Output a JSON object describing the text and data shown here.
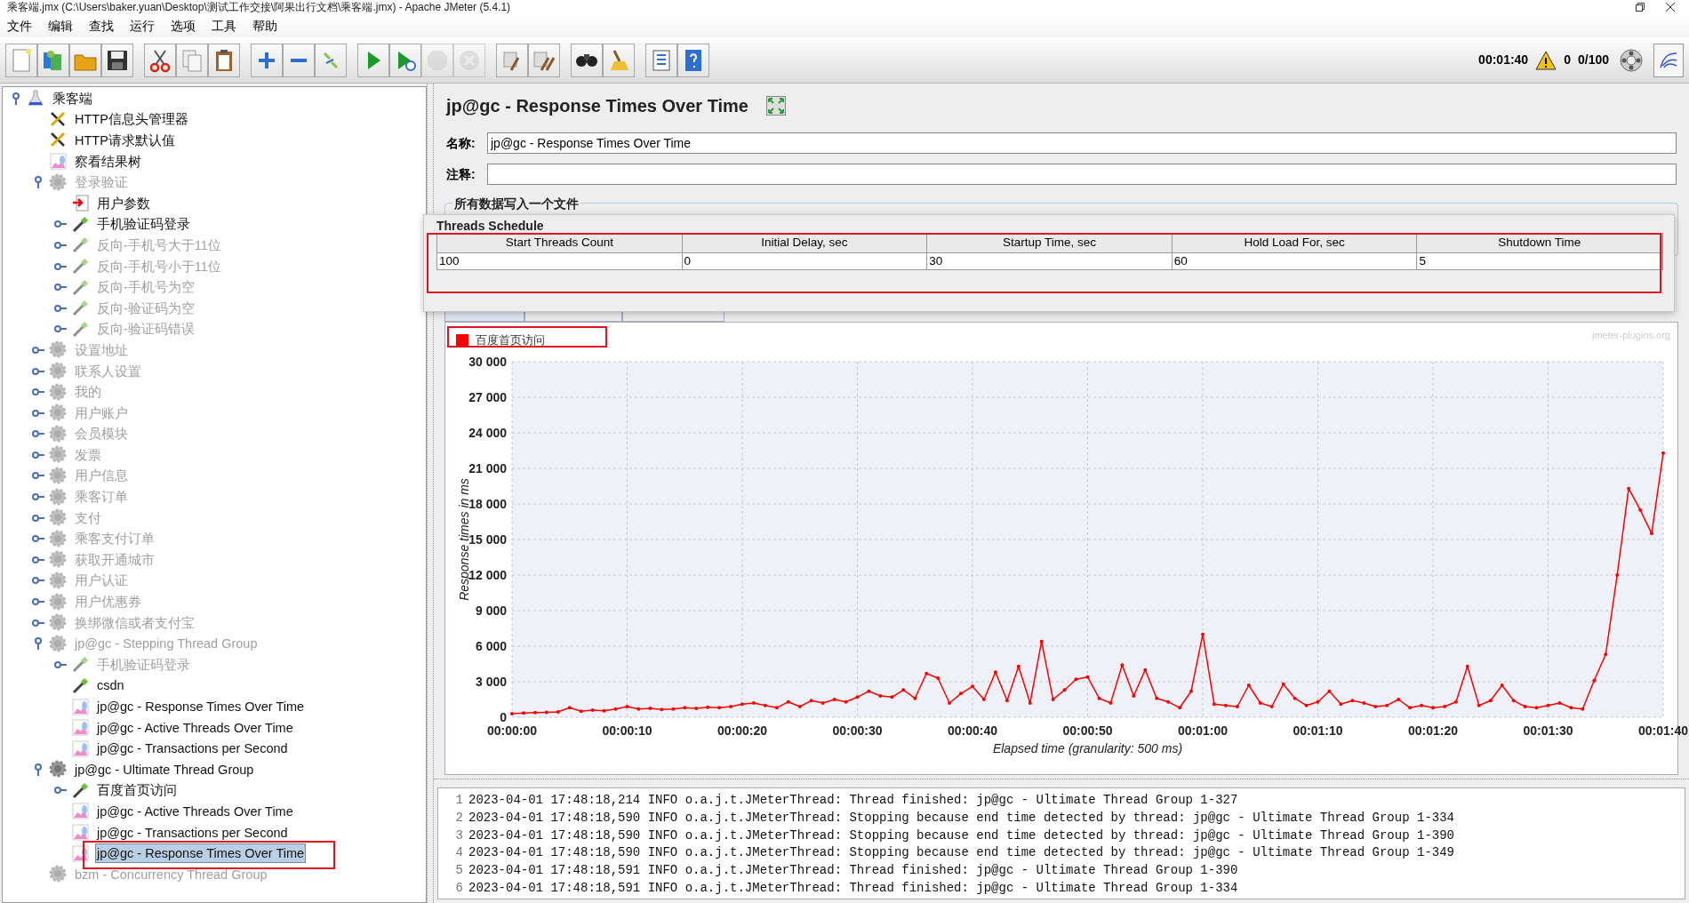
{
  "window": {
    "title": "乘客端.jmx (C:\\Users\\baker.yuan\\Desktop\\测试工作交接\\阿果出行文档\\乘客端.jmx) - Apache JMeter (5.4.1)"
  },
  "menu": [
    "文件",
    "编辑",
    "查找",
    "运行",
    "选项",
    "工具",
    "帮助"
  ],
  "toolbar": [
    {
      "disabled": false
    },
    {
      "disabled": false
    },
    {
      "disabled": false
    },
    {
      "disabled": false
    },
    {
      "disabled": false
    },
    {
      "disabled": false
    },
    {
      "disabled": false
    },
    {
      "disabled": false
    },
    {
      "disabled": false
    },
    {
      "disabled": false
    },
    {
      "disabled": false
    },
    {
      "disabled": false
    },
    {
      "disabled": true
    },
    {
      "disabled": true
    },
    {
      "disabled": false
    },
    {
      "disabled": false
    },
    {
      "disabled": false
    },
    {
      "disabled": false
    },
    {
      "disabled": false
    },
    {
      "disabled": false
    }
  ],
  "status": {
    "elapsed": "00:01:40",
    "errors": "0",
    "threads": "0/100"
  },
  "tree": [
    {
      "label": "乘客端",
      "kind": "plan",
      "disabled": false,
      "selected": false,
      "expanded": true,
      "children": [
        {
          "label": "HTTP信息头管理器",
          "kind": "config",
          "disabled": false,
          "selected": false
        },
        {
          "label": "HTTP请求默认值",
          "kind": "config",
          "disabled": false,
          "selected": false
        },
        {
          "label": "察看结果树",
          "kind": "listener",
          "disabled": false,
          "selected": false
        },
        {
          "label": "登录验证",
          "kind": "group",
          "disabled": true,
          "selected": false,
          "expanded": true,
          "children": [
            {
              "label": "用户参数",
              "kind": "preprocessor",
              "disabled": false,
              "selected": false
            },
            {
              "label": "手机验证码登录",
              "kind": "sampler",
              "disabled": false,
              "selected": false,
              "expanded": false
            },
            {
              "label": "反向-手机号大于11位",
              "kind": "sampler",
              "disabled": true,
              "selected": false,
              "expanded": false
            },
            {
              "label": "反向-手机号小于11位",
              "kind": "sampler",
              "disabled": true,
              "selected": false,
              "expanded": false
            },
            {
              "label": "反向-手机号为空",
              "kind": "sampler",
              "disabled": true,
              "selected": false,
              "expanded": false
            },
            {
              "label": "反向-验证码为空",
              "kind": "sampler",
              "disabled": true,
              "selected": false,
              "expanded": false
            },
            {
              "label": "反向-验证码错误",
              "kind": "sampler",
              "disabled": true,
              "selected": false,
              "expanded": false
            }
          ]
        },
        {
          "label": "设置地址",
          "kind": "group",
          "disabled": true,
          "selected": false,
          "expanded": false
        },
        {
          "label": "联系人设置",
          "kind": "group",
          "disabled": true,
          "selected": false,
          "expanded": false
        },
        {
          "label": "我的",
          "kind": "group",
          "disabled": true,
          "selected": false,
          "expanded": false
        },
        {
          "label": "用户账户",
          "kind": "group",
          "disabled": true,
          "selected": false,
          "expanded": false
        },
        {
          "label": "会员模块",
          "kind": "group",
          "disabled": true,
          "selected": false,
          "expanded": false
        },
        {
          "label": "发票",
          "kind": "group",
          "disabled": true,
          "selected": false,
          "expanded": false
        },
        {
          "label": "用户信息",
          "kind": "group",
          "disabled": true,
          "selected": false,
          "expanded": false
        },
        {
          "label": "乘客订单",
          "kind": "group",
          "disabled": true,
          "selected": false,
          "expanded": false
        },
        {
          "label": "支付",
          "kind": "group",
          "disabled": true,
          "selected": false,
          "expanded": false
        },
        {
          "label": "乘客支付订单",
          "kind": "group",
          "disabled": true,
          "selected": false,
          "expanded": false
        },
        {
          "label": "获取开通城市",
          "kind": "group",
          "disabled": true,
          "selected": false,
          "expanded": false
        },
        {
          "label": "用户认证",
          "kind": "group",
          "disabled": true,
          "selected": false,
          "expanded": false
        },
        {
          "label": "用户优惠券",
          "kind": "group",
          "disabled": true,
          "selected": false,
          "expanded": false
        },
        {
          "label": "换绑微信或者支付宝",
          "kind": "group",
          "disabled": true,
          "selected": false,
          "expanded": false
        },
        {
          "label": "jp@gc - Stepping Thread Group",
          "kind": "group",
          "disabled": true,
          "selected": false,
          "expanded": true,
          "children": [
            {
              "label": "手机验证码登录",
              "kind": "sampler",
              "disabled": true,
              "selected": false,
              "expanded": false
            },
            {
              "label": "csdn",
              "kind": "sampler",
              "disabled": false,
              "selected": false
            },
            {
              "label": "jp@gc - Response Times Over Time",
              "kind": "listener",
              "disabled": false,
              "selected": false
            },
            {
              "label": "jp@gc - Active Threads Over Time",
              "kind": "listener",
              "disabled": false,
              "selected": false
            },
            {
              "label": "jp@gc - Transactions per Second",
              "kind": "listener",
              "disabled": false,
              "selected": false
            }
          ]
        },
        {
          "label": "jp@gc - Ultimate Thread Group",
          "kind": "group",
          "disabled": false,
          "selected": false,
          "expanded": true,
          "children": [
            {
              "label": "百度首页访问",
              "kind": "sampler",
              "disabled": false,
              "selected": false,
              "expanded": false
            },
            {
              "label": "jp@gc - Active Threads Over Time",
              "kind": "listener",
              "disabled": false,
              "selected": false
            },
            {
              "label": "jp@gc - Transactions per Second",
              "kind": "listener",
              "disabled": false,
              "selected": false
            },
            {
              "label": "jp@gc - Response Times Over Time",
              "kind": "listener",
              "disabled": false,
              "selected": true
            }
          ]
        },
        {
          "label": "bzm - Concurrency Thread Group",
          "kind": "group",
          "disabled": true,
          "selected": false
        }
      ]
    }
  ],
  "panel": {
    "title": "jp@gc - Response Times Over Time",
    "name_label": "名称:",
    "name_value": "jp@gc - Response Times Over Time",
    "comment_label": "注释:",
    "file_legend": "所有数据写入一个文件"
  },
  "tabs": [
    {
      "selected": true
    },
    {
      "selected": false
    },
    {
      "selected": false
    }
  ],
  "threads_schedule": {
    "title": "Threads Schedule",
    "columns": [
      "Start Threads Count",
      "Initial Delay, sec",
      "Startup Time, sec",
      "Hold Load For, sec",
      "Shutdown Time"
    ],
    "row": [
      "100",
      "0",
      "30",
      "60",
      "5"
    ]
  },
  "chart": {
    "credit": "jmeter-plugins.org",
    "chart_data": {
      "type": "line",
      "xlabel": "Elapsed time (granularity: 500 ms)",
      "ylabel": "Response times in ms",
      "x": [
        0,
        1,
        2,
        3,
        4,
        5,
        6,
        7,
        8,
        9,
        10,
        11,
        12,
        13,
        14,
        15,
        16,
        17,
        18,
        19,
        20,
        21,
        22,
        23,
        24,
        25,
        26,
        27,
        28,
        29,
        30,
        31,
        32,
        33,
        34,
        35,
        36,
        37,
        38,
        39,
        40,
        41,
        42,
        43,
        44,
        45,
        46,
        47,
        48,
        49,
        50,
        51,
        52,
        53,
        54,
        55,
        56,
        57,
        58,
        59,
        60,
        61,
        62,
        63,
        64,
        65,
        66,
        67,
        68,
        69,
        70,
        71,
        72,
        73,
        74,
        75,
        76,
        77,
        78,
        79,
        80,
        81,
        82,
        83,
        84,
        85,
        86,
        87,
        88,
        89,
        90,
        91,
        92,
        93,
        94,
        95,
        96,
        97,
        98,
        99,
        100
      ],
      "series": [
        {
          "name": "百度首页访问",
          "color": "#ff0000",
          "values": [
            300,
            350,
            400,
            420,
            450,
            800,
            500,
            600,
            550,
            700,
            900,
            700,
            750,
            650,
            700,
            800,
            750,
            850,
            800,
            900,
            1100,
            1200,
            1000,
            800,
            1300,
            900,
            1400,
            1200,
            1500,
            1300,
            1700,
            2200,
            1800,
            1700,
            2300,
            1600,
            3700,
            3300,
            1200,
            2000,
            2600,
            1500,
            3800,
            1400,
            4300,
            1200,
            6400,
            1500,
            2300,
            3200,
            3400,
            1600,
            1200,
            4400,
            1800,
            4000,
            1600,
            1300,
            800,
            2200,
            7000,
            1100,
            1000,
            900,
            2700,
            1200,
            900,
            2800,
            1600,
            1000,
            1300,
            2200,
            1100,
            1400,
            1200,
            900,
            1000,
            1500,
            800,
            1000,
            800,
            900,
            1300,
            4300,
            1000,
            1400,
            2700,
            1400,
            900,
            800,
            1000,
            1200,
            800,
            700,
            3100,
            5300,
            12000,
            19300,
            17500,
            15500,
            22300
          ]
        }
      ],
      "xlim": [
        0,
        100
      ],
      "ylim": [
        0,
        30000
      ],
      "grid": true,
      "xticks": [
        {
          "value": 0,
          "label": "00:00:00"
        },
        {
          "value": 10,
          "label": "00:00:10"
        },
        {
          "value": 20,
          "label": "00:00:20"
        },
        {
          "value": 30,
          "label": "00:00:30"
        },
        {
          "value": 40,
          "label": "00:00:40"
        },
        {
          "value": 50,
          "label": "00:00:50"
        },
        {
          "value": 60,
          "label": "00:01:00"
        },
        {
          "value": 70,
          "label": "00:01:10"
        },
        {
          "value": 80,
          "label": "00:01:20"
        },
        {
          "value": 90,
          "label": "00:01:30"
        },
        {
          "value": 100,
          "label": "00:01:40"
        }
      ],
      "yticks": [
        {
          "value": 0,
          "label": "0"
        },
        {
          "value": 3000,
          "label": "3 000"
        },
        {
          "value": 6000,
          "label": "6 000"
        },
        {
          "value": 9000,
          "label": "9 000"
        },
        {
          "value": 12000,
          "label": "12 000"
        },
        {
          "value": 15000,
          "label": "15 000"
        },
        {
          "value": 18000,
          "label": "18 000"
        },
        {
          "value": 21000,
          "label": "21 000"
        },
        {
          "value": 24000,
          "label": "24 000"
        },
        {
          "value": 27000,
          "label": "27 000"
        },
        {
          "value": 30000,
          "label": "30 000"
        }
      ]
    }
  },
  "log": [
    {
      "line": "1",
      "text": "2023-04-01 17:48:18,214 INFO o.a.j.t.JMeterThread: Thread finished: jp@gc - Ultimate Thread Group 1-327"
    },
    {
      "line": "2",
      "text": "2023-04-01 17:48:18,590 INFO o.a.j.t.JMeterThread: Stopping because end time detected by thread: jp@gc - Ultimate Thread Group 1-334"
    },
    {
      "line": "3",
      "text": "2023-04-01 17:48:18,590 INFO o.a.j.t.JMeterThread: Stopping because end time detected by thread: jp@gc - Ultimate Thread Group 1-390"
    },
    {
      "line": "4",
      "text": "2023-04-01 17:48:18,590 INFO o.a.j.t.JMeterThread: Stopping because end time detected by thread: jp@gc - Ultimate Thread Group 1-349"
    },
    {
      "line": "5",
      "text": "2023-04-01 17:48:18,591 INFO o.a.j.t.JMeterThread: Thread finished: jp@gc - Ultimate Thread Group 1-390"
    },
    {
      "line": "6",
      "text": "2023-04-01 17:48:18,591 INFO o.a.j.t.JMeterThread: Thread finished: jp@gc - Ultimate Thread Group 1-334"
    }
  ]
}
